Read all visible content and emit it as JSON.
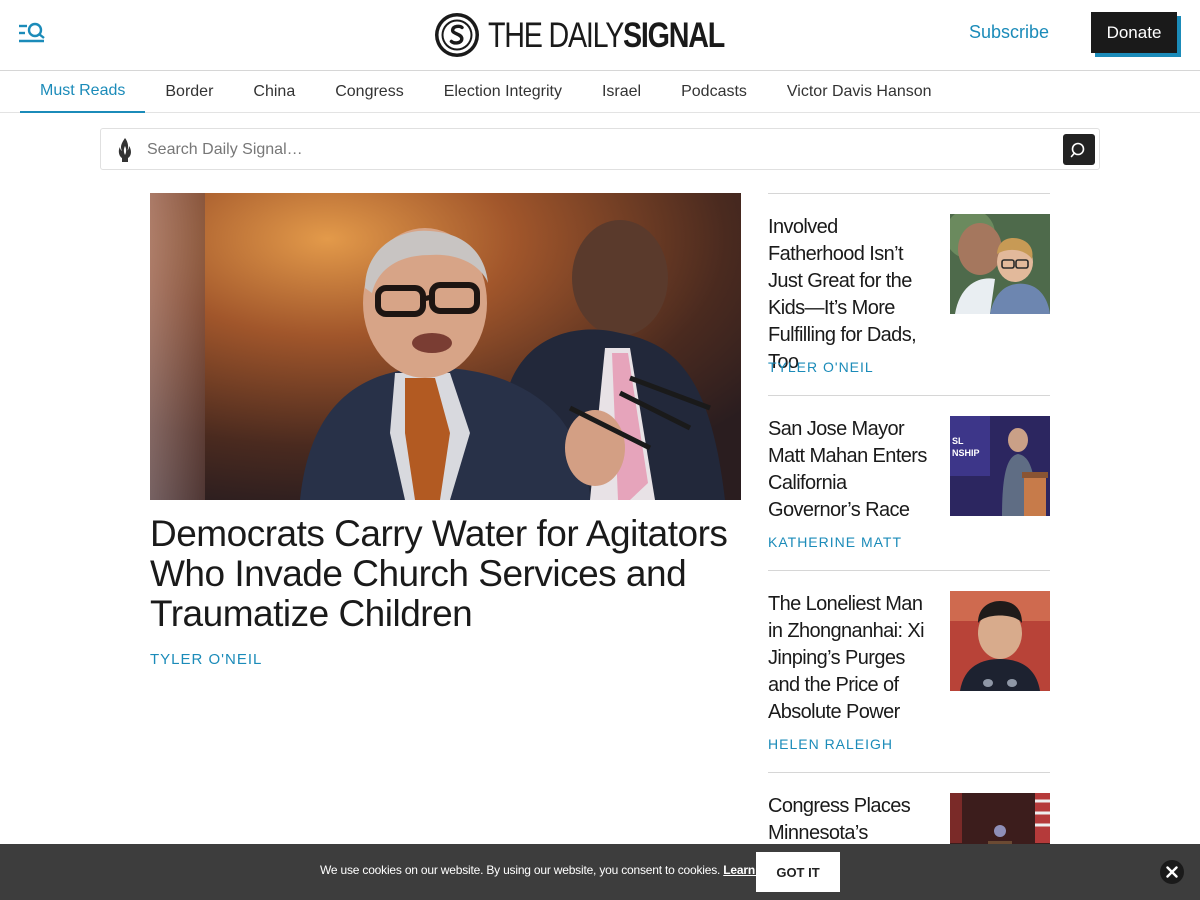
{
  "header": {
    "logo_light": "THE DAILY",
    "logo_bold": "SIGNAL",
    "subscribe_label": "Subscribe",
    "donate_label": "Donate"
  },
  "nav": {
    "items": [
      {
        "label": "Must Reads",
        "active": true
      },
      {
        "label": "Border"
      },
      {
        "label": "China"
      },
      {
        "label": "Congress"
      },
      {
        "label": "Election Integrity"
      },
      {
        "label": "Israel"
      },
      {
        "label": "Podcasts"
      },
      {
        "label": "Victor Davis Hanson"
      }
    ]
  },
  "search": {
    "placeholder": "Search Daily Signal…",
    "icon": "search-icon"
  },
  "lead": {
    "title": "Democrats Carry Water for Agitators Who Invade Church Services and Traumatize Children",
    "author": "TYLER O'NEIL"
  },
  "stories": [
    {
      "title": "Involved Fatherhood Isn’t Just Great for the Kids—It’s More Fulfilling for Dads, Too",
      "author": "TYLER O'NEIL"
    },
    {
      "title": "San Jose Mayor Matt Mahan Enters California Governor’s Race",
      "author": "KATHERINE MATT"
    },
    {
      "title": "The Loneliest Man in Zhongnanhai: Xi Jinping’s Purges and the Price of Absolute Power",
      "author": "HELEN RALEIGH"
    },
    {
      "title": "Congress Places Minnesota’s Rampant",
      "author": ""
    }
  ],
  "cookie": {
    "text": "We use cookies on our website. By using our website, you consent to cookies.",
    "link_label": "Learn More",
    "suffix": ".",
    "button_label": "GOT IT"
  },
  "colors": {
    "accent": "#1b8bb9",
    "dark": "#1a1a1a",
    "cookie_bg": "#3d3d3d"
  }
}
